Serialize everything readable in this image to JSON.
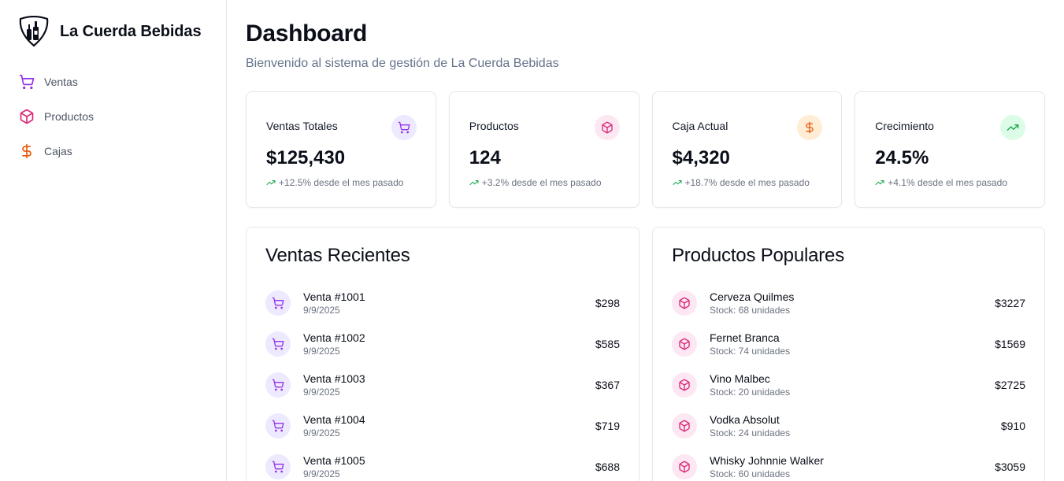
{
  "brand": {
    "name": "La Cuerda Bebidas"
  },
  "nav": [
    {
      "label": "Ventas",
      "icon": "cart-icon",
      "color": "#9333ea"
    },
    {
      "label": "Productos",
      "icon": "package-icon",
      "color": "#db2777"
    },
    {
      "label": "Cajas",
      "icon": "dollar-icon",
      "color": "#ea580c"
    }
  ],
  "header": {
    "title": "Dashboard",
    "subtitle": "Bienvenido al sistema de gestión de La Cuerda Bebidas"
  },
  "stats": [
    {
      "title": "Ventas Totales",
      "value": "$125,430",
      "change": "+12.5% desde el mes pasado",
      "icon": "cart-icon",
      "color": "#9333ea"
    },
    {
      "title": "Productos",
      "value": "124",
      "change": "+3.2% desde el mes pasado",
      "icon": "package-icon",
      "color": "#db2777"
    },
    {
      "title": "Caja Actual",
      "value": "$4,320",
      "change": "+18.7% desde el mes pasado",
      "icon": "dollar-icon",
      "color": "#ea580c"
    },
    {
      "title": "Crecimiento",
      "value": "24.5%",
      "change": "+4.1% desde el mes pasado",
      "icon": "trending-up-icon",
      "color": "#16a34a"
    }
  ],
  "recent_sales": {
    "title": "Ventas Recientes",
    "items": [
      {
        "title": "Venta #1001",
        "date": "9/9/2025",
        "amount": "$298"
      },
      {
        "title": "Venta #1002",
        "date": "9/9/2025",
        "amount": "$585"
      },
      {
        "title": "Venta #1003",
        "date": "9/9/2025",
        "amount": "$367"
      },
      {
        "title": "Venta #1004",
        "date": "9/9/2025",
        "amount": "$719"
      },
      {
        "title": "Venta #1005",
        "date": "9/9/2025",
        "amount": "$688"
      }
    ]
  },
  "popular_products": {
    "title": "Productos Populares",
    "items": [
      {
        "name": "Cerveza Quilmes",
        "stock": "Stock: 68 unidades",
        "price": "$3227"
      },
      {
        "name": "Fernet Branca",
        "stock": "Stock: 74 unidades",
        "price": "$1569"
      },
      {
        "name": "Vino Malbec",
        "stock": "Stock: 20 unidades",
        "price": "$2725"
      },
      {
        "name": "Vodka Absolut",
        "stock": "Stock: 24 unidades",
        "price": "$910"
      },
      {
        "name": "Whisky Johnnie Walker",
        "stock": "Stock: 60 unidades",
        "price": "$3059"
      }
    ]
  },
  "colors": {
    "trend": "#16a34a",
    "purple": "#9333ea",
    "pink": "#db2777",
    "orange": "#ea580c"
  }
}
